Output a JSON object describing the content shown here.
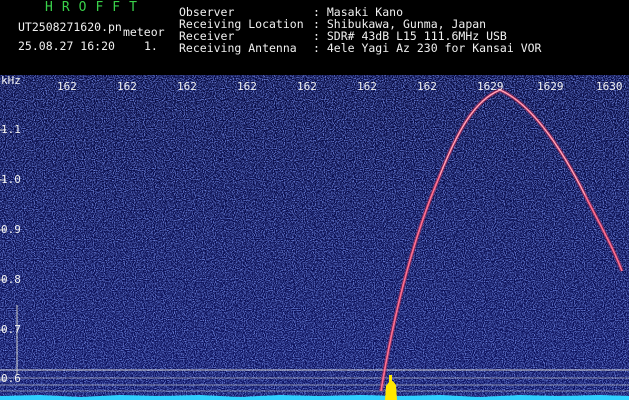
{
  "header": {
    "brand": "HROFFT",
    "filename": "UT2508271620.pn",
    "tag": "meteor",
    "datetime": "25.08.27 16:20",
    "index": "1.",
    "fields": [
      {
        "label": "Observer",
        "value": ": Masaki Kano"
      },
      {
        "label": "Receiving Location",
        "value": ": Shibukawa, Gunma, Japan"
      },
      {
        "label": "Receiver",
        "value": ": SDR# 43dB L15 111.6MHz USB"
      },
      {
        "label": "Receiving Antenna",
        "value": ": 4ele Yagi Az 230 for Kansai VOR"
      }
    ]
  },
  "plot": {
    "y_unit": "kHz",
    "y_ticks": [
      "1.1",
      "1.0",
      "0.9",
      "0.8",
      "0.7",
      "0.6"
    ],
    "x_ticks": [
      "162",
      "162",
      "162",
      "162",
      "162",
      "162",
      "162",
      "1629",
      "1629",
      "1630"
    ],
    "colors": {
      "background": "#070a52",
      "noise_blue": "#2a3db8",
      "trace": "#d64a6a",
      "trace_core": "#f0a0b0",
      "baseline": "#2fd0ff",
      "marker": "#ffe800",
      "guide": "#c8c8c8"
    }
  }
}
